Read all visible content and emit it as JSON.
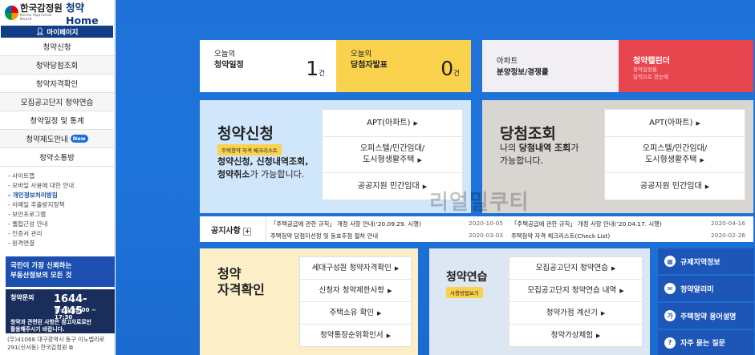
{
  "sidebar": {
    "logo_text": "한국감정원",
    "logo_sub": "Korea Appraisal Board",
    "logo_app": "청약Home",
    "mypage": "마이페이지",
    "menu": [
      "청약신청",
      "청약당첨조회",
      "청약자격확인",
      "모집공고단지 청약연습",
      "청약일정 및 통계",
      "청약제도안내",
      "청약소통방"
    ],
    "new_badge": "New",
    "sublinks": [
      "- 사이트맵",
      "- 모바일 사용에 대한 안내",
      "- 개인정보처리방침",
      "- 이메일 추출방지정책",
      "- 보안프로그램",
      "- 웹접근성 안내",
      "- 인증서 관리",
      "- 원격연결"
    ],
    "banner1": [
      "국민이 가장 신뢰하는",
      "부동산정보의 모든 것"
    ],
    "callcenter": {
      "title": "청약문의",
      "phone": "1644-7445",
      "hours": "월~금 09:00 ~ 17:30",
      "note": [
        "청약과 관련된 사항은 참고자료로만",
        "활용해주시기 바랍니다."
      ]
    },
    "address": [
      "(우)41068 대구광역시 동구 이노밸리로",
      "291(신서동) 한국감정원"
    ]
  },
  "stats": {
    "today_schedule": {
      "l1": "오늘의",
      "l2": "청약일정",
      "count": "1",
      "unit": "건"
    },
    "today_winner": {
      "l1": "오늘의",
      "l2": "당첨자발표",
      "count": "0",
      "unit": "건"
    },
    "apt": {
      "l1": "아파트",
      "l2": "분양정보/경쟁률"
    },
    "calendar": {
      "title": "청약캘린더",
      "desc": [
        "청약일정을",
        "달력으로 한눈에"
      ]
    }
  },
  "apply": {
    "title": "청약신청",
    "badge": "주택청약 자격 체크리스트",
    "desc_b1": "청약신청, 신청내역조회,",
    "desc_b2": "청약취소",
    "desc_t2": "가 가능합니다.",
    "links": [
      "APT(아파트)",
      "오피스텔/민간임대/",
      "도시형생활주택",
      "공공지원 민간임대"
    ]
  },
  "result": {
    "title": "당첨조회",
    "desc_t1": "나의 ",
    "desc_b1": "당첨내역 조회",
    "desc_t1b": "가",
    "desc_t2": "가능합니다.",
    "links": [
      "APT(아파트)",
      "오피스텔/민간임대/",
      "도시형생활주택",
      "공공지원 민간임대"
    ]
  },
  "notice": {
    "title": "공지사항",
    "items": [
      {
        "text": "「주택공급에 관한 규칙」 개정 사항 안내(’20.09.29. 시행)",
        "date": "2020-10-05"
      },
      {
        "text": "「주택공급에 관한 규칙」 개정 사항 안내(’20.04.17. 시행)",
        "date": "2020-04-16"
      },
      {
        "text": "주택청약 당첨자선정 및 동호추첨 절차 안내",
        "date": "2020-03-03"
      },
      {
        "text": "주택청약 자격 체크리스트(Check List)",
        "date": "2020-02-26"
      }
    ]
  },
  "qualify": {
    "title1": "청약",
    "title2": "자격확인",
    "links": [
      "세대구성원 청약자격확인",
      "신청자 청약제한사항",
      "주택소유 확인",
      "청약통장순위확인서"
    ]
  },
  "practice": {
    "title": "청약연습",
    "badge": "사용방법보기",
    "links": [
      "모집공고단지 청약연습",
      "모집공고단지 청약연습 내역",
      "청약가점 계산기",
      "청약가상체험"
    ]
  },
  "quick": [
    "규제지역정보",
    "청약알리미",
    "주택청약 용어설명",
    "자주 묻는 질문"
  ],
  "watermark": "리얼밀쿠티",
  "colors": {
    "main_blue": "#1f71d8",
    "yellow": "#fbd24e",
    "calendar_red": "#e8464e",
    "navy": "#123e86"
  }
}
